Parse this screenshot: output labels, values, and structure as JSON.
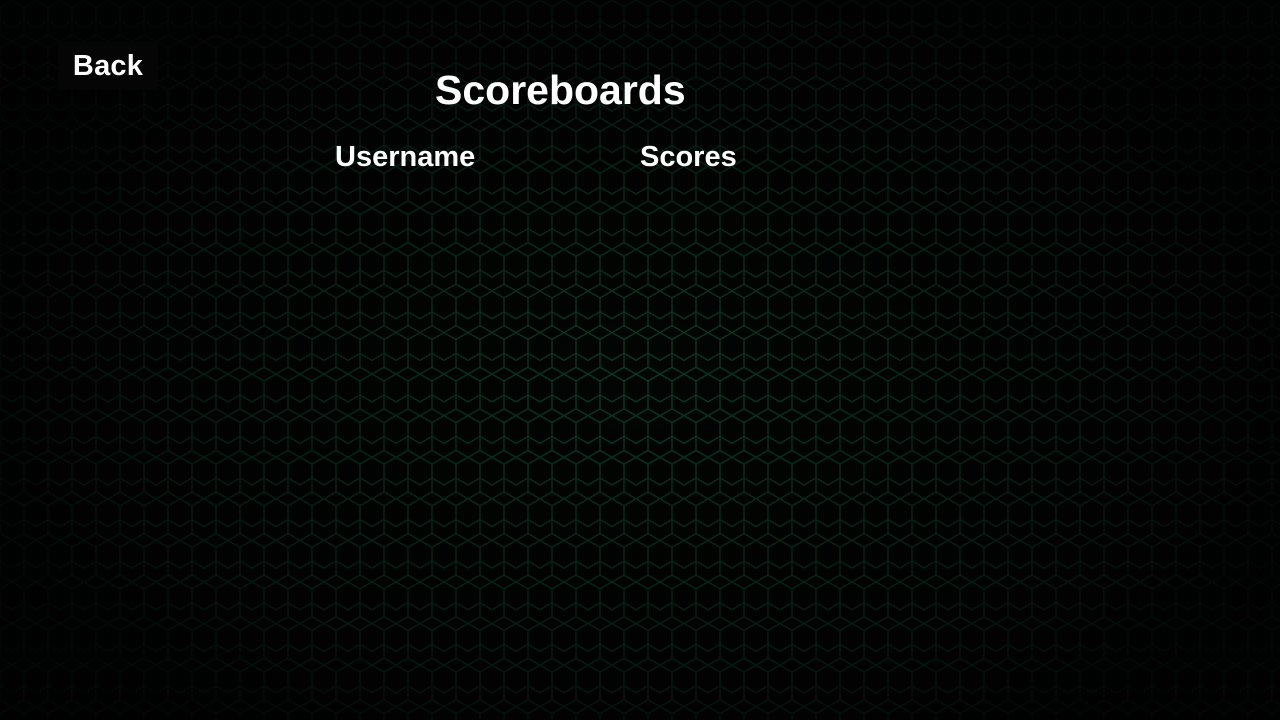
{
  "screen": {
    "back_label": "Back",
    "title": "Scoreboards"
  },
  "scoreboard": {
    "columns": [
      "Username",
      "Scores"
    ],
    "rows": []
  },
  "colors": {
    "background": "#000000",
    "hex_pattern": "#0b3a24",
    "text": "#ffffff",
    "button_bg": "#050505"
  }
}
